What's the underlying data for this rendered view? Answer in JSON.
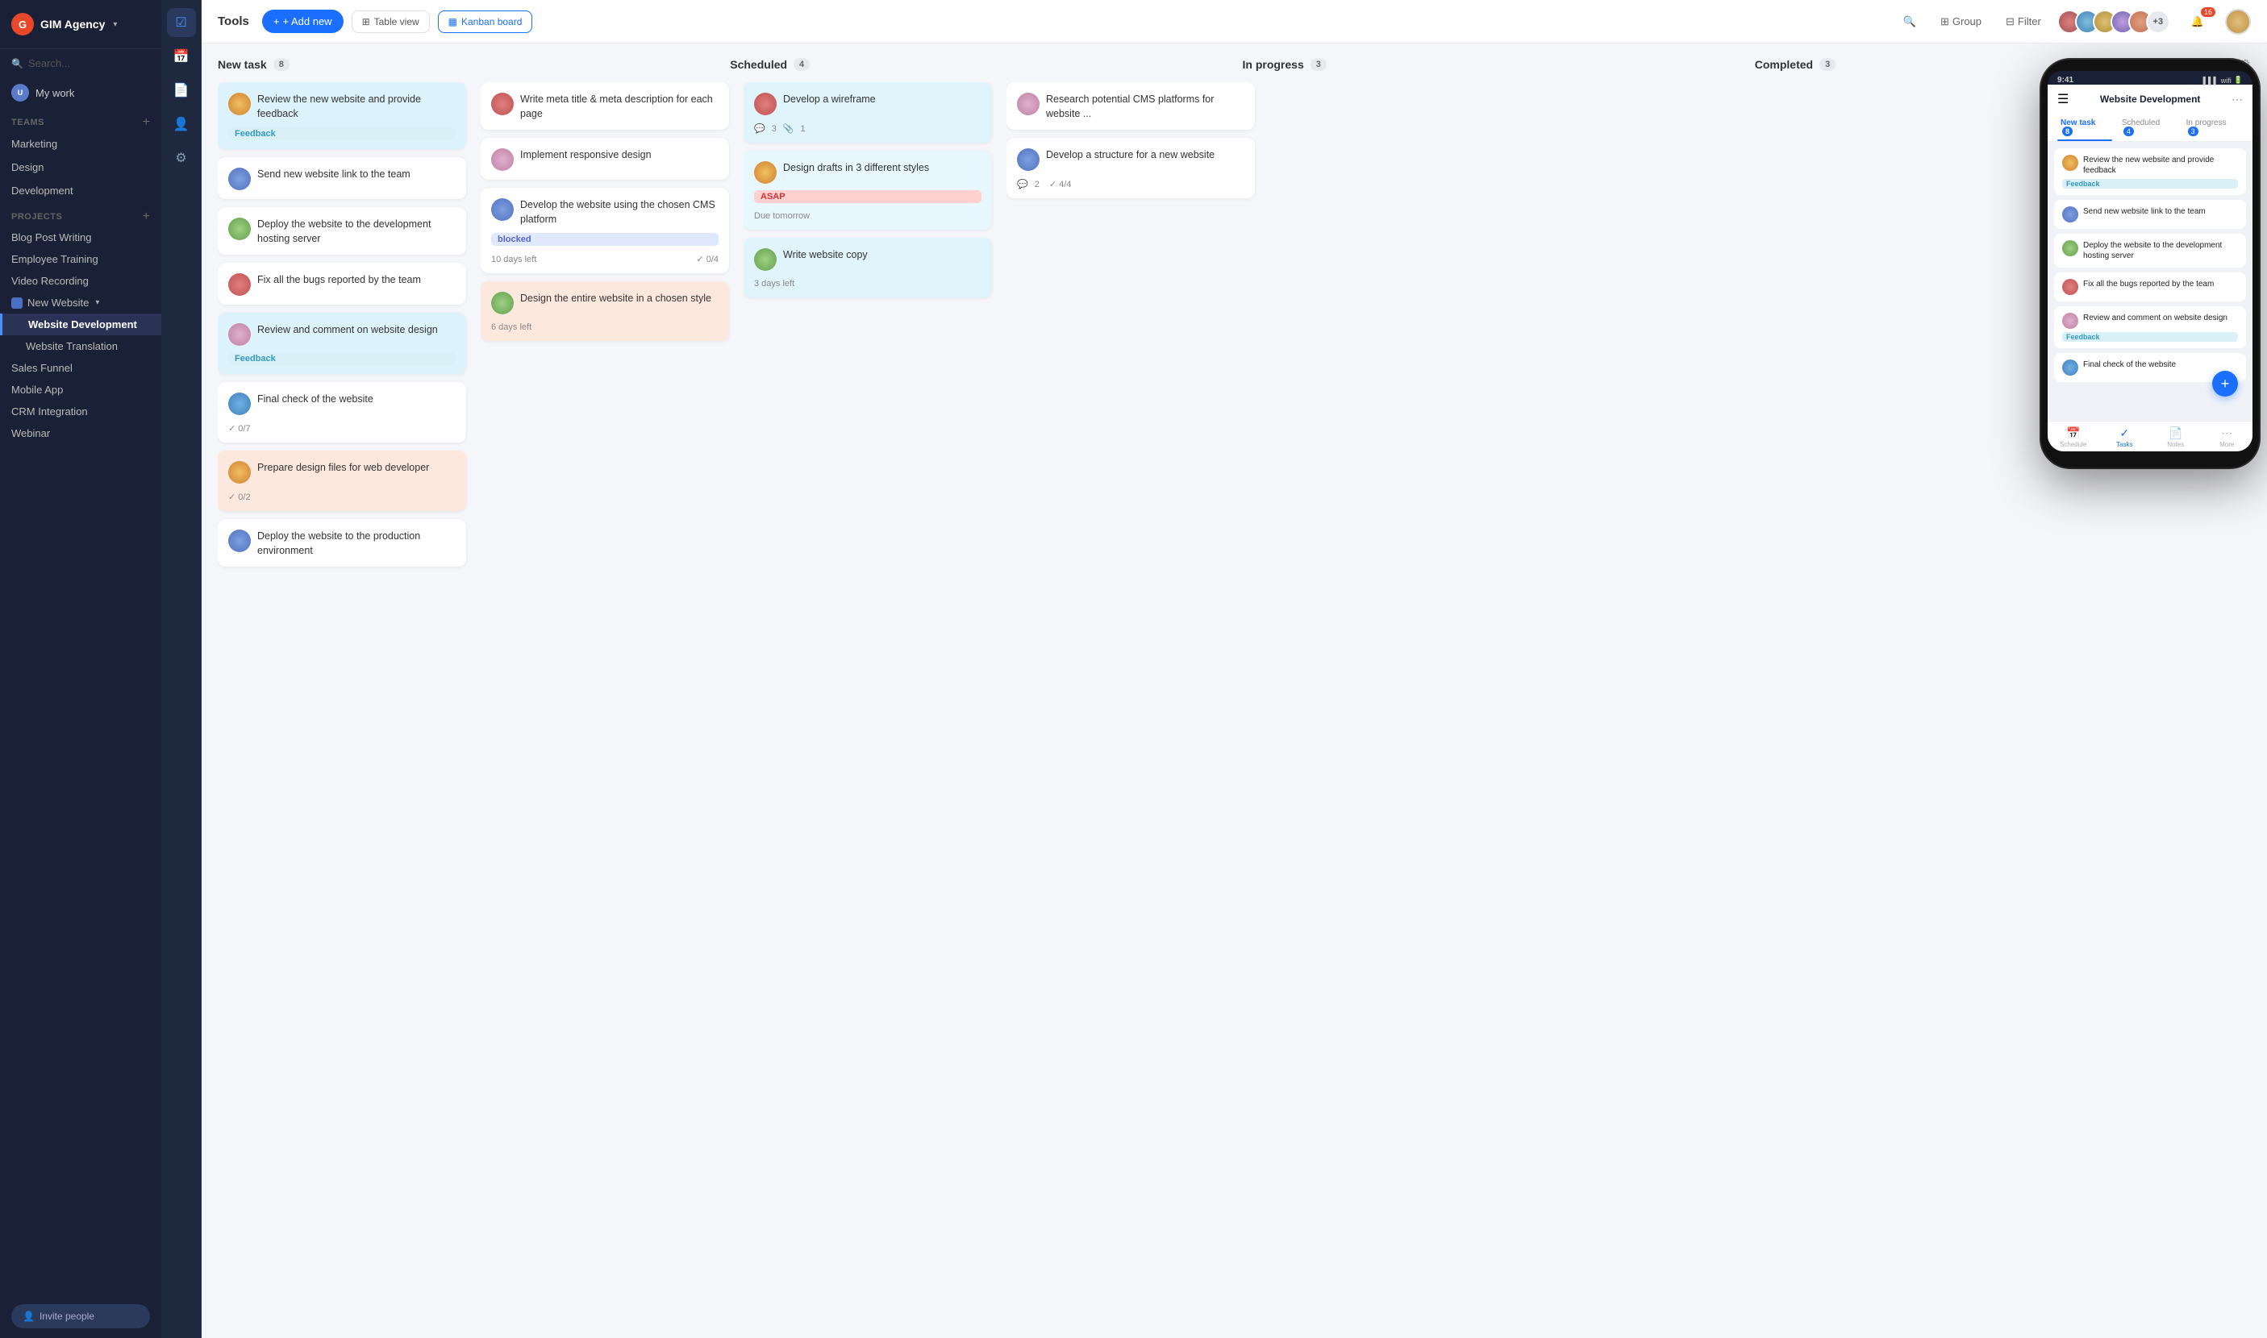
{
  "app": {
    "name": "GIM Agency",
    "logo_letter": "G"
  },
  "sidebar": {
    "search_placeholder": "Search...",
    "my_work": "My work",
    "teams_label": "Teams",
    "teams": [
      {
        "label": "Marketing"
      },
      {
        "label": "Design"
      },
      {
        "label": "Development"
      }
    ],
    "projects_label": "Projects",
    "projects": [
      {
        "label": "Blog Post Writing"
      },
      {
        "label": "Employee Training"
      },
      {
        "label": "Video Recording"
      },
      {
        "label": "New Website",
        "expandable": true
      },
      {
        "label": "Website Development",
        "subitem": true,
        "active": true
      },
      {
        "label": "Website Translation",
        "subitem": true
      },
      {
        "label": "Sales Funnel"
      },
      {
        "label": "Mobile App"
      },
      {
        "label": "CRM Integration"
      },
      {
        "label": "Webinar"
      }
    ],
    "invite_label": "Invite people"
  },
  "toolbar": {
    "tools_label": "Tools",
    "add_label": "+ Add new",
    "table_view": "Table view",
    "kanban_board": "Kanban board",
    "group_label": "Group",
    "filter_label": "Filter",
    "avatar_extra": "+3"
  },
  "board": {
    "columns": [
      {
        "id": "new_task",
        "title": "New task",
        "count": 8,
        "cards": [
          {
            "id": "nt1",
            "title": "Review the new website and provide feedback",
            "tag": "Feedback",
            "tag_type": "feedback",
            "av": "1"
          },
          {
            "id": "nt2",
            "title": "Send new website link to the team",
            "av": "3"
          },
          {
            "id": "nt3",
            "title": "Deploy the website to the development hosting server",
            "av": "4"
          },
          {
            "id": "nt4",
            "title": "Fix all the bugs reported by the team",
            "av": "2"
          },
          {
            "id": "nt5",
            "title": "Review and comment on website design",
            "tag": "Feedback",
            "tag_type": "feedback",
            "av": "5"
          },
          {
            "id": "nt6",
            "title": "Final check of the website",
            "checks": "✓ 0/7",
            "av": "6"
          },
          {
            "id": "nt7",
            "title": "Prepare design files for web developer",
            "checks": "✓ 0/2",
            "av": "1",
            "salmon": true
          },
          {
            "id": "nt8",
            "title": "Deploy the website to the production environment",
            "av": "3"
          }
        ]
      },
      {
        "id": "scheduled",
        "title": "Scheduled",
        "count": 4,
        "cards": [
          {
            "id": "sc1",
            "title": "Write meta title & meta description for each page",
            "av": "2"
          },
          {
            "id": "sc2",
            "title": "Implement responsive design",
            "av": "5"
          },
          {
            "id": "sc3",
            "title": "Develop the website using the chosen CMS platform",
            "tag": "blocked",
            "tag_type": "blocked",
            "days": "10 days left",
            "checks": "✓ 0/4",
            "av": "3"
          },
          {
            "id": "sc4",
            "title": "Design the entire website in a chosen style",
            "days": "6 days left",
            "av": "4",
            "salmon": true
          }
        ]
      },
      {
        "id": "in_progress",
        "title": "In progress",
        "count": 3,
        "cards": [
          {
            "id": "ip1",
            "title": "Develop a wireframe",
            "comments": "3",
            "attachments": "1",
            "av": "2"
          },
          {
            "id": "ip2",
            "title": "Design drafts in 3 different styles",
            "tag": "ASAP",
            "tag_type": "asap",
            "due": "Due tomorrow",
            "av": "1",
            "salmon": true
          },
          {
            "id": "ip3",
            "title": "Write website copy",
            "days": "3 days left",
            "av": "4"
          }
        ]
      },
      {
        "id": "completed",
        "title": "Completed",
        "count": 3,
        "cards": [
          {
            "id": "co1",
            "title": "Research potential CMS platforms for website ...",
            "av": "5"
          },
          {
            "id": "co2",
            "title": "Develop a structure for a new website",
            "comments": "2",
            "checks": "✓ 4/4",
            "av": "3"
          }
        ]
      }
    ]
  },
  "phone": {
    "time": "9:41",
    "title": "Website Development",
    "tabs": [
      {
        "label": "New task",
        "badge": "8"
      },
      {
        "label": "Scheduled",
        "badge": "4"
      },
      {
        "label": "In progress",
        "badge": "3"
      }
    ],
    "cards": [
      {
        "title": "Review the new website and provide feedback",
        "tag": "Feedback",
        "av": "1"
      },
      {
        "title": "Send new website link to the team",
        "av": "2"
      },
      {
        "title": "Deploy the website to the development hosting server",
        "av": "3"
      },
      {
        "title": "Fix all the bugs reported by the team",
        "av": "4"
      },
      {
        "title": "Review and comment on website design",
        "tag": "Feedback",
        "av": "5"
      },
      {
        "title": "Final check of the website",
        "av": "6"
      }
    ],
    "bottom_nav": [
      {
        "label": "Schedule",
        "icon": "📅"
      },
      {
        "label": "Tasks",
        "icon": "✓",
        "active": true
      },
      {
        "label": "Notes",
        "icon": "📄"
      },
      {
        "label": "More",
        "icon": "⋯"
      }
    ]
  },
  "icons": {
    "hamburger": "☰",
    "plus": "+",
    "check": "✓",
    "search": "🔍",
    "group": "⊞",
    "filter": "⊟",
    "settings": "⚙",
    "chevron_down": "▾",
    "chevron_right": "›",
    "bell": "🔔",
    "notif_count": "16",
    "comment": "💬",
    "paperclip": "📎",
    "arrow_right": "›",
    "task_check": "☑",
    "calendar": "📅",
    "person": "👤",
    "gear": "⚙"
  }
}
